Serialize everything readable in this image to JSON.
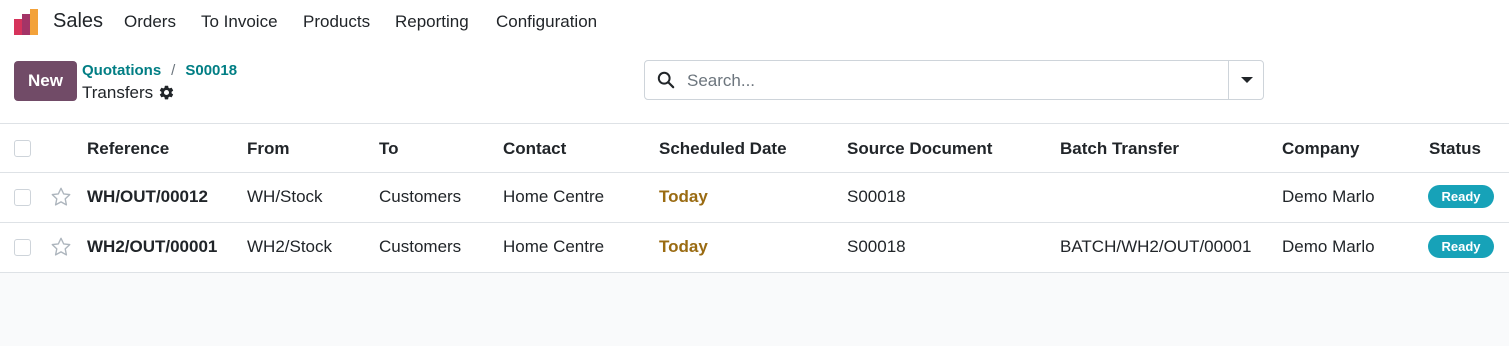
{
  "nav": {
    "app_name": "Sales",
    "menu": [
      "Orders",
      "To Invoice",
      "Products",
      "Reporting",
      "Configuration"
    ]
  },
  "control": {
    "new_label": "New",
    "breadcrumb": [
      "Quotations",
      "S00018"
    ],
    "breadcrumb_sep": "/",
    "title": "Transfers"
  },
  "search": {
    "placeholder": "Search...",
    "value": ""
  },
  "table": {
    "columns": [
      "Reference",
      "From",
      "To",
      "Contact",
      "Scheduled Date",
      "Source Document",
      "Batch Transfer",
      "Company",
      "Status"
    ],
    "rows": [
      {
        "reference": "WH/OUT/00012",
        "from": "WH/Stock",
        "to": "Customers",
        "contact": "Home Centre",
        "scheduled_date": "Today",
        "source_document": "S00018",
        "batch_transfer": "",
        "company": "Demo Marlo",
        "status": "Ready"
      },
      {
        "reference": "WH2/OUT/00001",
        "from": "WH2/Stock",
        "to": "Customers",
        "contact": "Home Centre",
        "scheduled_date": "Today",
        "source_document": "S00018",
        "batch_transfer": "BATCH/WH2/OUT/00001",
        "company": "Demo Marlo",
        "status": "Ready"
      }
    ]
  },
  "colors": {
    "primary": "#714b67",
    "link": "#017e84",
    "today": "#9a6b12",
    "status_ready": "#17a2b8"
  },
  "icons": {
    "logo": "sales-app-icon",
    "settings": "gear-icon",
    "search": "search-icon",
    "toggle": "caret-down-icon",
    "favorite": "star-icon"
  }
}
